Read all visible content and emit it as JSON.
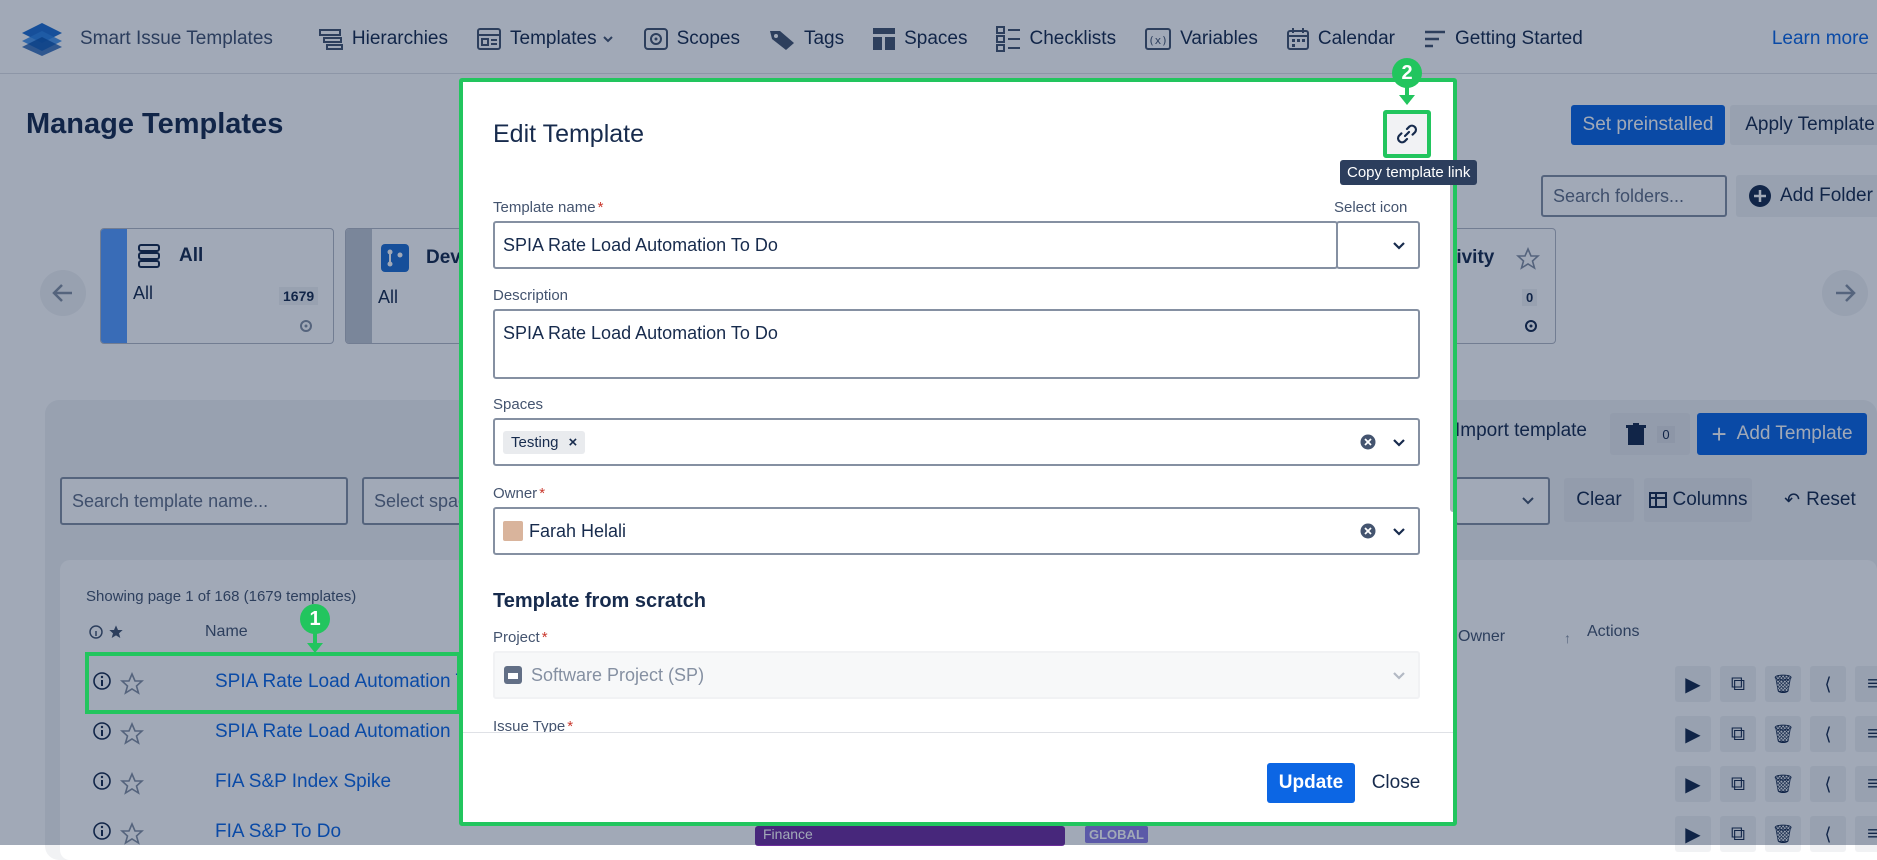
{
  "app": {
    "name": "Smart Issue Templates"
  },
  "nav": {
    "items": [
      {
        "label": "Hierarchies",
        "icon": "hierarchy-icon"
      },
      {
        "label": "Templates",
        "icon": "templates-icon",
        "has_dropdown": true
      },
      {
        "label": "Scopes",
        "icon": "scope-icon"
      },
      {
        "label": "Tags",
        "icon": "tag-icon"
      },
      {
        "label": "Spaces",
        "icon": "spaces-icon"
      },
      {
        "label": "Checklists",
        "icon": "checklist-icon"
      },
      {
        "label": "Variables",
        "icon": "variables-icon"
      },
      {
        "label": "Calendar",
        "icon": "calendar-icon"
      },
      {
        "label": "Getting Started",
        "icon": "getting-started-icon"
      }
    ],
    "learn_more": "Learn more"
  },
  "page": {
    "title": "Manage Templates",
    "set_preinstalled": "Set preinstalled",
    "apply_template": "Apply Template",
    "search_folders_placeholder": "Search folders...",
    "add_folder": "Add Folder"
  },
  "folders": [
    {
      "title": "All",
      "subtitle": "All",
      "count": "1679"
    },
    {
      "title": "Dev",
      "subtitle": "All"
    },
    {
      "title": "tivity",
      "count": "0"
    }
  ],
  "toolbar": {
    "import_template": "Import template",
    "trash_count": "0",
    "add_template": "Add Template",
    "search_template_placeholder": "Search template name...",
    "select_space_placeholder": "Select spac",
    "clear": "Clear",
    "columns": "Columns",
    "reset": "Reset"
  },
  "table": {
    "showing": "Showing page 1 of 168 (1679 templates)",
    "col_name": "Name",
    "col_owner": "Owner",
    "col_actions": "Actions",
    "rows": [
      {
        "name": "SPIA Rate Load Automation To"
      },
      {
        "name": "SPIA Rate Load Automation"
      },
      {
        "name": "FIA S&P Index Spike"
      },
      {
        "name": "FIA S&P To Do",
        "badge": "Finance",
        "scope": "GLOBAL"
      }
    ]
  },
  "modal": {
    "title": "Edit Template",
    "tooltip": "Copy template link",
    "template_name_label": "Template name",
    "template_name_value": "SPIA Rate Load Automation To Do",
    "select_icon_label": "Select icon",
    "description_label": "Description",
    "description_value": "SPIA Rate Load Automation To Do",
    "spaces_label": "Spaces",
    "spaces_tag": "Testing",
    "owner_label": "Owner",
    "owner_value": "Farah Helali",
    "section_title": "Template from scratch",
    "project_label": "Project",
    "project_value": "Software Project (SP)",
    "issue_type_label": "Issue Type",
    "update": "Update",
    "close": "Close"
  },
  "annotations": {
    "step1": "1",
    "step2": "2"
  },
  "colors": {
    "accent": "#0c66e4",
    "highlight": "#22c55e",
    "badge_finance": "#6e2e9e",
    "badge_global": "#8f7ee7"
  }
}
